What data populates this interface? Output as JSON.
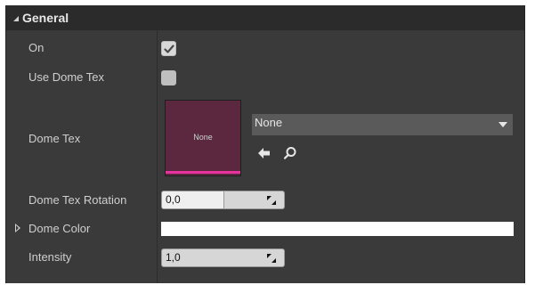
{
  "section": {
    "title": "General",
    "expanded": true
  },
  "properties": {
    "on": {
      "label": "On",
      "checked": true
    },
    "use_dome_tex": {
      "label": "Use Dome Tex",
      "checked": false
    },
    "dome_tex": {
      "label": "Dome Tex",
      "thumbnail_text": "None",
      "asset_value": "None",
      "thumbnail_color": "#5b2840",
      "thumbnail_accent": "#e8339e"
    },
    "dome_tex_rotation": {
      "label": "Dome Tex Rotation",
      "value": "0,0",
      "slider_fraction": 0.5
    },
    "dome_color": {
      "label": "Dome Color",
      "color": "#ffffff"
    },
    "intensity": {
      "label": "Intensity",
      "value": "1,0"
    }
  },
  "icons": {
    "section_collapse": "triangle-icon",
    "expand": "expand-arrow-icon",
    "use_selected": "arrow-left-icon",
    "browse": "search-icon",
    "combo_open": "chevron-down-icon",
    "spin_drag": "resize-arrows-icon"
  }
}
